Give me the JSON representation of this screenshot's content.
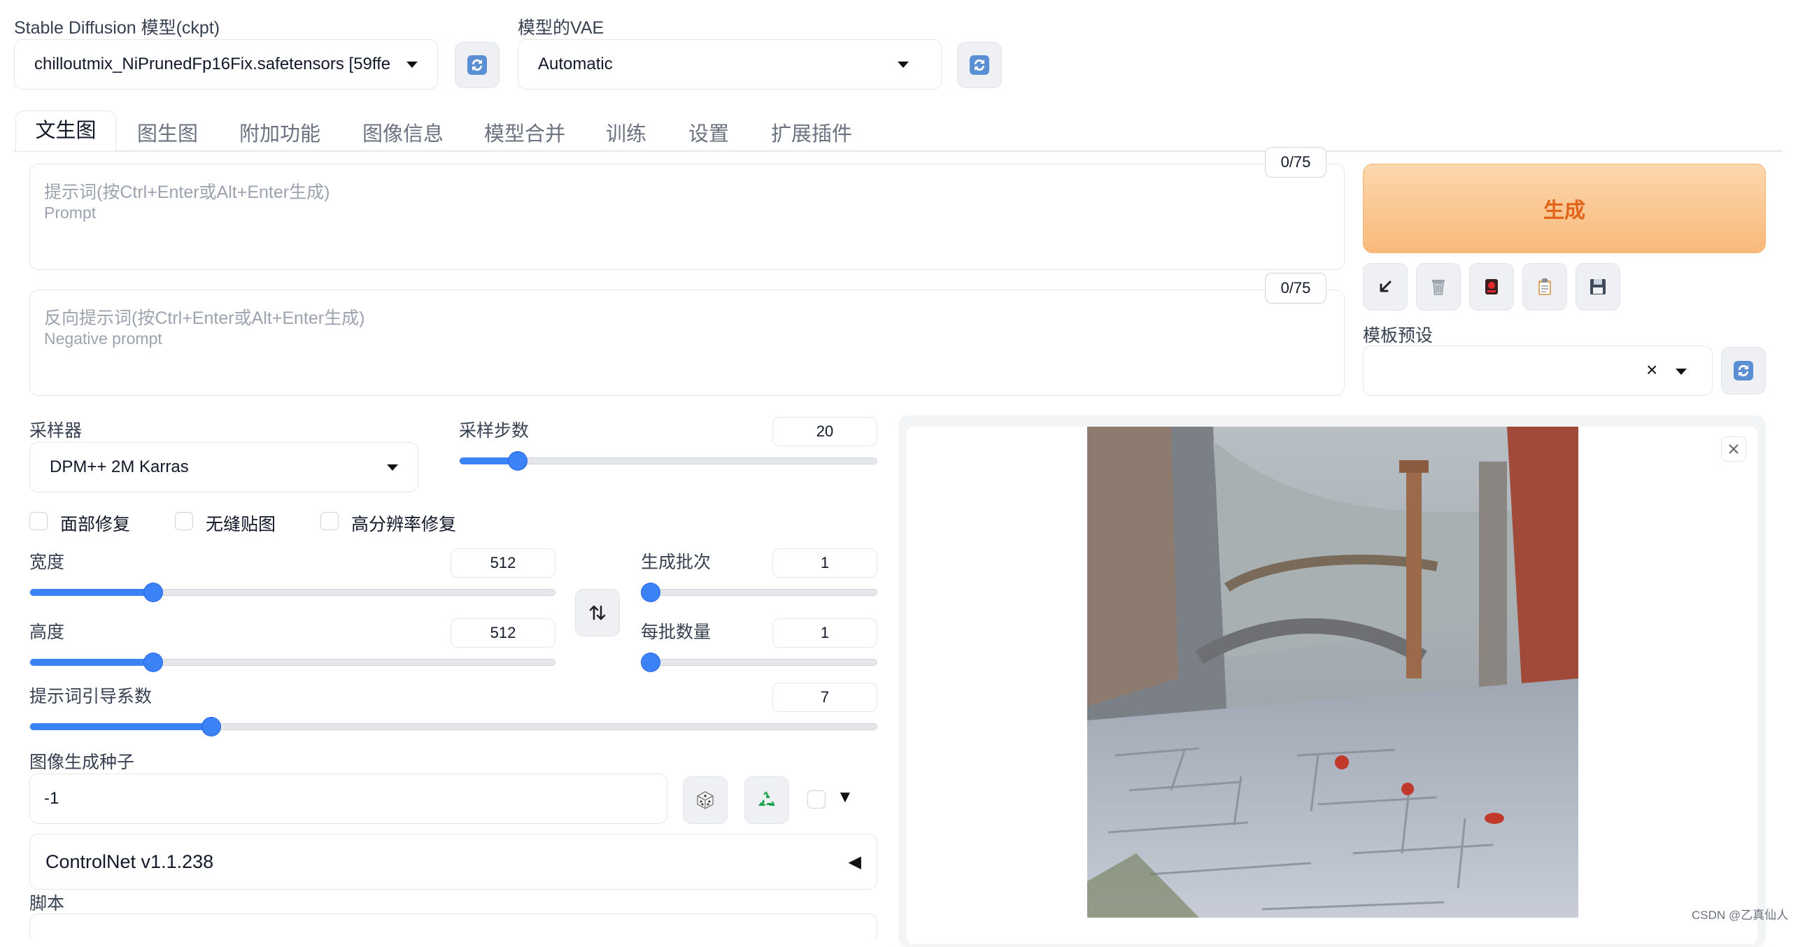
{
  "model": {
    "label": "Stable Diffusion 模型(ckpt)",
    "value": "chilloutmix_NiPrunedFp16Fix.safetensors [59ffe"
  },
  "vae": {
    "label": "模型的VAE",
    "value": "Automatic"
  },
  "tabs": [
    "文生图",
    "图生图",
    "附加功能",
    "图像信息",
    "模型合并",
    "训练",
    "设置",
    "扩展插件"
  ],
  "prompt": {
    "placeholder1": "提示词(按Ctrl+Enter或Alt+Enter生成)",
    "placeholder2": "Prompt",
    "counter": "0/75"
  },
  "negative_prompt": {
    "placeholder1": "反向提示词(按Ctrl+Enter或Alt+Enter生成)",
    "placeholder2": "Negative prompt",
    "counter": "0/75"
  },
  "generate_label": "生成",
  "styles": {
    "label": "模板预设",
    "clear": "×"
  },
  "sampler": {
    "label": "采样器",
    "value": "DPM++ 2M Karras"
  },
  "steps": {
    "label": "采样步数",
    "value": "20",
    "fraction": 0.14
  },
  "checkboxes": [
    "面部修复",
    "无缝贴图",
    "高分辨率修复"
  ],
  "width": {
    "label": "宽度",
    "value": "512",
    "fraction": 0.235
  },
  "height": {
    "label": "高度",
    "value": "512",
    "fraction": 0.235
  },
  "batch_count": {
    "label": "生成批次",
    "value": "1",
    "fraction": 0.0
  },
  "batch_size": {
    "label": "每批数量",
    "value": "1",
    "fraction": 0.0
  },
  "cfg": {
    "label": "提示词引导系数",
    "value": "7",
    "fraction": 0.214
  },
  "seed": {
    "label": "图像生成种子",
    "value": "-1"
  },
  "controlnet": {
    "label": "ControlNet v1.1.238",
    "arrow": "◀"
  },
  "script_label": "脚本",
  "extra_arrow": "▼",
  "watermark": "CSDN @乙真仙人",
  "colors": {
    "accent": "#3b82f6",
    "generate_bg": "#fbc58e",
    "generate_text": "#e0651b"
  },
  "icons": [
    "refresh-icon",
    "arrow-down-left-icon",
    "trash-icon",
    "red-card-icon",
    "clipboard-icon",
    "save-icon",
    "swap-icon",
    "dice-icon",
    "recycle-icon",
    "close-icon"
  ]
}
